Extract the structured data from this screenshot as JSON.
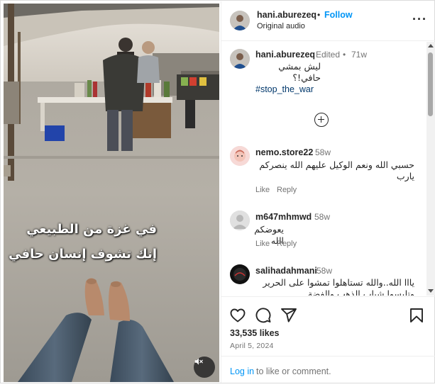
{
  "post": {
    "username": "hani.aburezeq",
    "follow_label": "Follow",
    "dot": "•",
    "audio": "Original audio",
    "more_label": "···",
    "video_caption_line1": "في غزة من الطبيعي",
    "video_caption_line2": "إنك تشوف إنسان حافي"
  },
  "caption": {
    "username": "hani.aburezeq",
    "edited": "Edited",
    "age": "71w",
    "text": "ليش بمشي حافي!؟",
    "hashtag": "#stop_the_war"
  },
  "comments": [
    {
      "username": "nemo.store22",
      "age": "58w",
      "text_line1": "حسبي الله ونعم الوكيل عليهم الله ينصركم",
      "text_line2": "يارب",
      "like_label": "Like",
      "reply_label": "Reply"
    },
    {
      "username": "m647mhmwd",
      "age": "58w",
      "text_line1": "يعوضكم الله",
      "like_label": "Like",
      "reply_label": "Reply"
    },
    {
      "username": "salihadahmani",
      "age": "58w",
      "text_line1": "يااا الله..والله تستاهلوا تمشوا على الحرير",
      "text_line2": "وتلبسوا شباب الذهب والفضة"
    }
  ],
  "stats": {
    "likes": "33,535 likes",
    "date": "April 5, 2024"
  },
  "login": {
    "link": "Log in",
    "rest": "to like or comment."
  },
  "colors": {
    "accent": "#0095f6",
    "hashtag": "#00376b",
    "muted": "#737373",
    "text": "#262626"
  },
  "icons": [
    "heart-icon",
    "comment-icon",
    "share-icon",
    "bookmark-icon",
    "mute-icon",
    "plus-circle-icon",
    "more-icon"
  ]
}
